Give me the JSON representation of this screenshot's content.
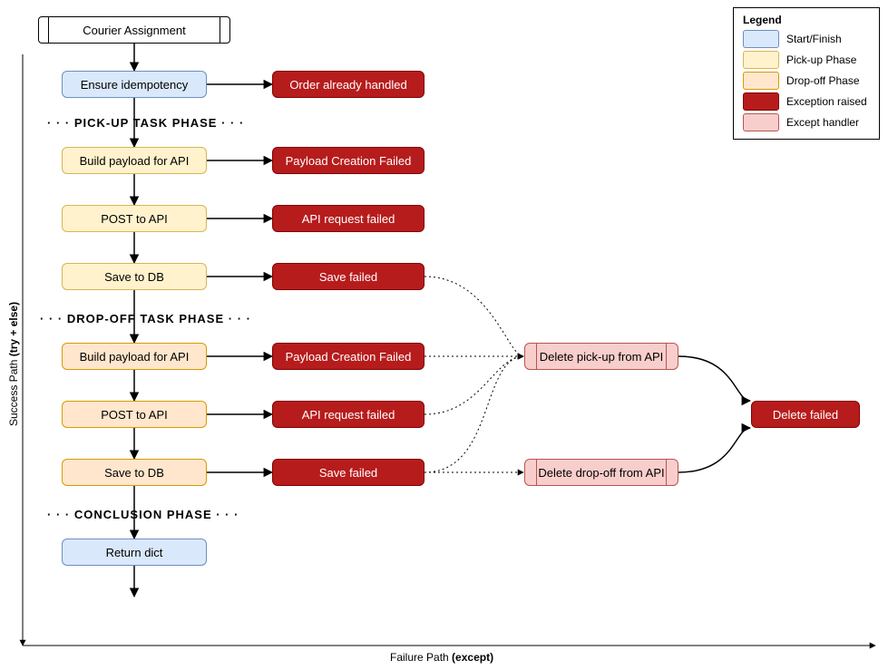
{
  "header": "Courier Assignment",
  "steps": {
    "idem": "Ensure idempotency",
    "pk_build": "Build payload for API",
    "pk_post": "POST to API",
    "pk_save": "Save to DB",
    "do_build": "Build payload for API",
    "do_post": "POST to API",
    "do_save": "Save to DB",
    "return": "Return dict"
  },
  "errors": {
    "handled": "Order already handled",
    "payload_fail": "Payload Creation Failed",
    "api_fail": "API request failed",
    "save_fail": "Save failed",
    "payload_fail2": "Payload Creation Failed",
    "api_fail2": "API request failed",
    "save_fail2": "Save failed",
    "delete_fail": "Delete failed"
  },
  "handlers": {
    "del_pickup": "Delete pick-up from API",
    "del_dropoff": "Delete drop-off from API"
  },
  "phases": {
    "pickup": "PICK-UP TASK PHASE",
    "dropoff": "DROP-OFF TASK PHASE",
    "conclusion": "CONCLUSION PHASE"
  },
  "legend": {
    "title": "Legend",
    "start": "Start/Finish",
    "pickup": "Pick-up Phase",
    "dropoff": "Drop-off Phase",
    "exception": "Exception raised",
    "handler": "Except handler"
  },
  "axes": {
    "y_prefix": "Success Path ",
    "y_bold": "(try + else)",
    "x_prefix": "Failure Path ",
    "x_bold": "(except)"
  },
  "chart_data": {
    "type": "flowchart",
    "columns": [
      "success_path",
      "exception",
      "except_handler",
      "terminal_exception"
    ],
    "nodes": [
      {
        "id": "header",
        "label": "Courier Assignment",
        "kind": "start",
        "col": "success_path"
      },
      {
        "id": "idem",
        "label": "Ensure idempotency",
        "kind": "start_finish",
        "col": "success_path"
      },
      {
        "id": "pk_build",
        "label": "Build payload for API",
        "kind": "pickup",
        "col": "success_path"
      },
      {
        "id": "pk_post",
        "label": "POST to API",
        "kind": "pickup",
        "col": "success_path"
      },
      {
        "id": "pk_save",
        "label": "Save to DB",
        "kind": "pickup",
        "col": "success_path"
      },
      {
        "id": "do_build",
        "label": "Build payload for API",
        "kind": "dropoff",
        "col": "success_path"
      },
      {
        "id": "do_post",
        "label": "POST to API",
        "kind": "dropoff",
        "col": "success_path"
      },
      {
        "id": "do_save",
        "label": "Save to DB",
        "kind": "dropoff",
        "col": "success_path"
      },
      {
        "id": "return",
        "label": "Return dict",
        "kind": "start_finish",
        "col": "success_path"
      },
      {
        "id": "e_handled",
        "label": "Order already handled",
        "kind": "exception",
        "col": "exception"
      },
      {
        "id": "e_payload1",
        "label": "Payload Creation Failed",
        "kind": "exception",
        "col": "exception"
      },
      {
        "id": "e_api1",
        "label": "API request failed",
        "kind": "exception",
        "col": "exception"
      },
      {
        "id": "e_save1",
        "label": "Save failed",
        "kind": "exception",
        "col": "exception"
      },
      {
        "id": "e_payload2",
        "label": "Payload Creation Failed",
        "kind": "exception",
        "col": "exception"
      },
      {
        "id": "e_api2",
        "label": "API request failed",
        "kind": "exception",
        "col": "exception"
      },
      {
        "id": "e_save2",
        "label": "Save failed",
        "kind": "exception",
        "col": "exception"
      },
      {
        "id": "h_pickup",
        "label": "Delete pick-up from API",
        "kind": "handler",
        "col": "except_handler"
      },
      {
        "id": "h_dropoff",
        "label": "Delete drop-off from API",
        "kind": "handler",
        "col": "except_handler"
      },
      {
        "id": "e_deletefail",
        "label": "Delete failed",
        "kind": "exception",
        "col": "terminal_exception"
      }
    ],
    "edges": [
      {
        "from": "header",
        "to": "idem",
        "style": "solid"
      },
      {
        "from": "idem",
        "to": "pk_build",
        "style": "solid"
      },
      {
        "from": "pk_build",
        "to": "pk_post",
        "style": "solid"
      },
      {
        "from": "pk_post",
        "to": "pk_save",
        "style": "solid"
      },
      {
        "from": "pk_save",
        "to": "do_build",
        "style": "solid"
      },
      {
        "from": "do_build",
        "to": "do_post",
        "style": "solid"
      },
      {
        "from": "do_post",
        "to": "do_save",
        "style": "solid"
      },
      {
        "from": "do_save",
        "to": "return",
        "style": "solid"
      },
      {
        "from": "idem",
        "to": "e_handled",
        "style": "solid"
      },
      {
        "from": "pk_build",
        "to": "e_payload1",
        "style": "solid"
      },
      {
        "from": "pk_post",
        "to": "e_api1",
        "style": "solid"
      },
      {
        "from": "pk_save",
        "to": "e_save1",
        "style": "solid"
      },
      {
        "from": "do_build",
        "to": "e_payload2",
        "style": "solid"
      },
      {
        "from": "do_post",
        "to": "e_api2",
        "style": "solid"
      },
      {
        "from": "do_save",
        "to": "e_save2",
        "style": "solid"
      },
      {
        "from": "e_save1",
        "to": "h_pickup",
        "style": "dotted"
      },
      {
        "from": "e_payload2",
        "to": "h_pickup",
        "style": "dotted"
      },
      {
        "from": "e_api2",
        "to": "h_pickup",
        "style": "dotted"
      },
      {
        "from": "e_save2",
        "to": "h_pickup",
        "style": "dotted"
      },
      {
        "from": "e_save2",
        "to": "h_dropoff",
        "style": "dotted"
      },
      {
        "from": "h_pickup",
        "to": "e_deletefail",
        "style": "solid"
      },
      {
        "from": "h_dropoff",
        "to": "e_deletefail",
        "style": "solid"
      }
    ],
    "phase_dividers": [
      {
        "after": "idem",
        "label": "PICK-UP TASK PHASE"
      },
      {
        "after": "pk_save",
        "label": "DROP-OFF TASK PHASE"
      },
      {
        "after": "do_save",
        "label": "CONCLUSION PHASE"
      }
    ],
    "axes": {
      "y": "Success Path (try + else)",
      "x": "Failure Path (except)"
    }
  }
}
